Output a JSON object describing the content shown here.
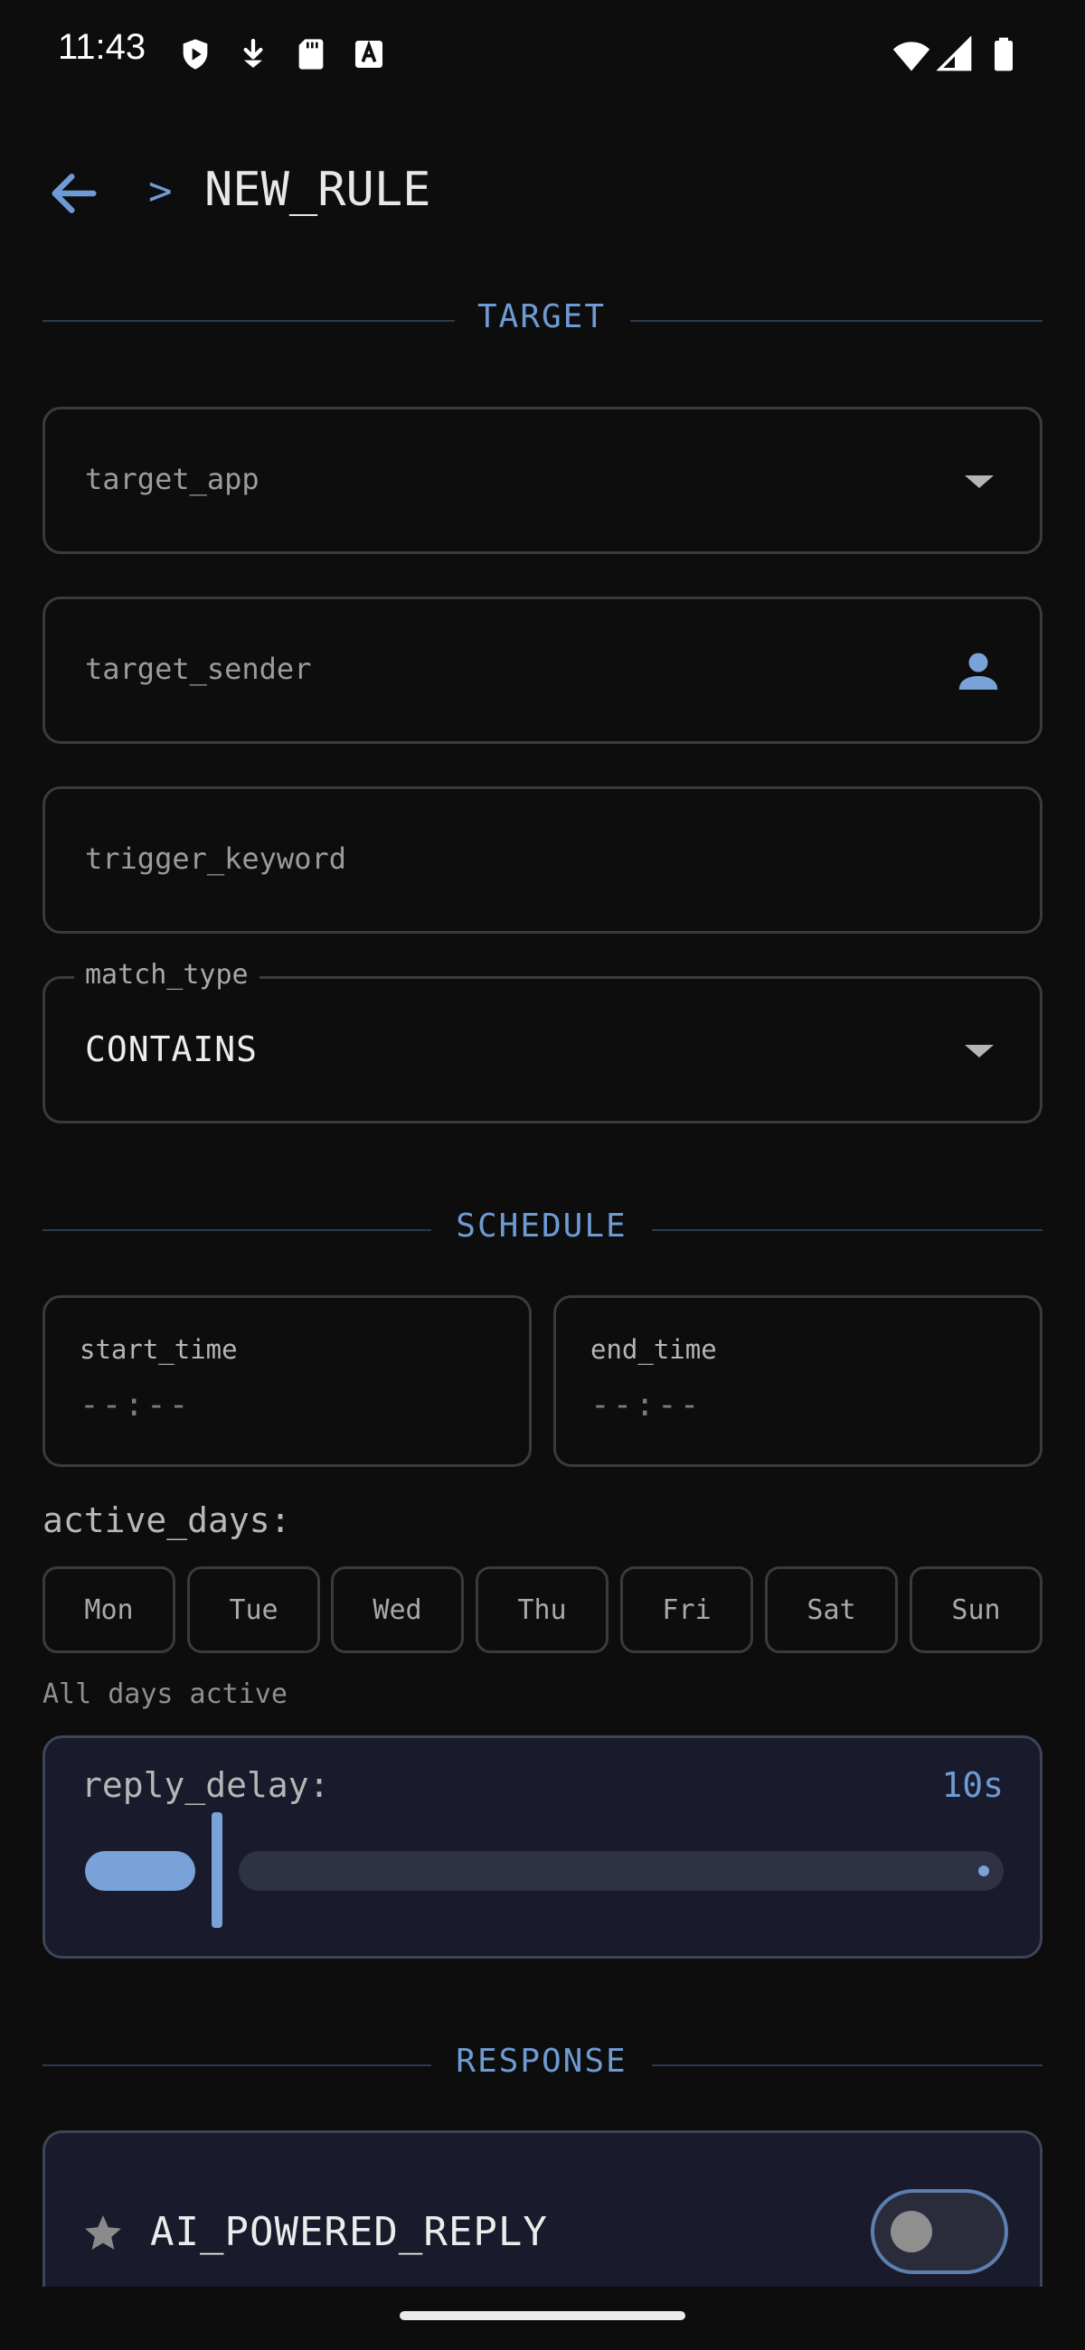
{
  "status_bar": {
    "time": "11:43",
    "left_icons": [
      "play-shield-icon",
      "download-icon",
      "sd-card-icon",
      "text-a-icon"
    ],
    "right_icons": [
      "wifi-icon",
      "cell-signal-icon",
      "battery-icon"
    ]
  },
  "header": {
    "prompt": ">",
    "title": "NEW_RULE",
    "back_icon": "arrow-left-icon"
  },
  "sections": {
    "target": "TARGET",
    "schedule": "SCHEDULE",
    "response": "RESPONSE"
  },
  "target": {
    "app_placeholder": "target_app",
    "sender_placeholder": "target_sender",
    "keyword_placeholder": "trigger_keyword",
    "match_type_label": "match_type",
    "match_type_value": "CONTAINS"
  },
  "schedule": {
    "start_label": "start_time",
    "start_value": "--:--",
    "end_label": "end_time",
    "end_value": "--:--",
    "active_days_label": "active_days:",
    "days": [
      "Mon",
      "Tue",
      "Wed",
      "Thu",
      "Fri",
      "Sat",
      "Sun"
    ],
    "days_hint": "All days active"
  },
  "reply_delay": {
    "label": "reply_delay:",
    "value": "10s",
    "fraction": 0.12
  },
  "response": {
    "ai_label": "AI_POWERED_REPLY",
    "ai_enabled": false
  },
  "colors": {
    "accent": "#6e9bd4",
    "background": "#0d0d0d",
    "panel": "#191a2b"
  }
}
